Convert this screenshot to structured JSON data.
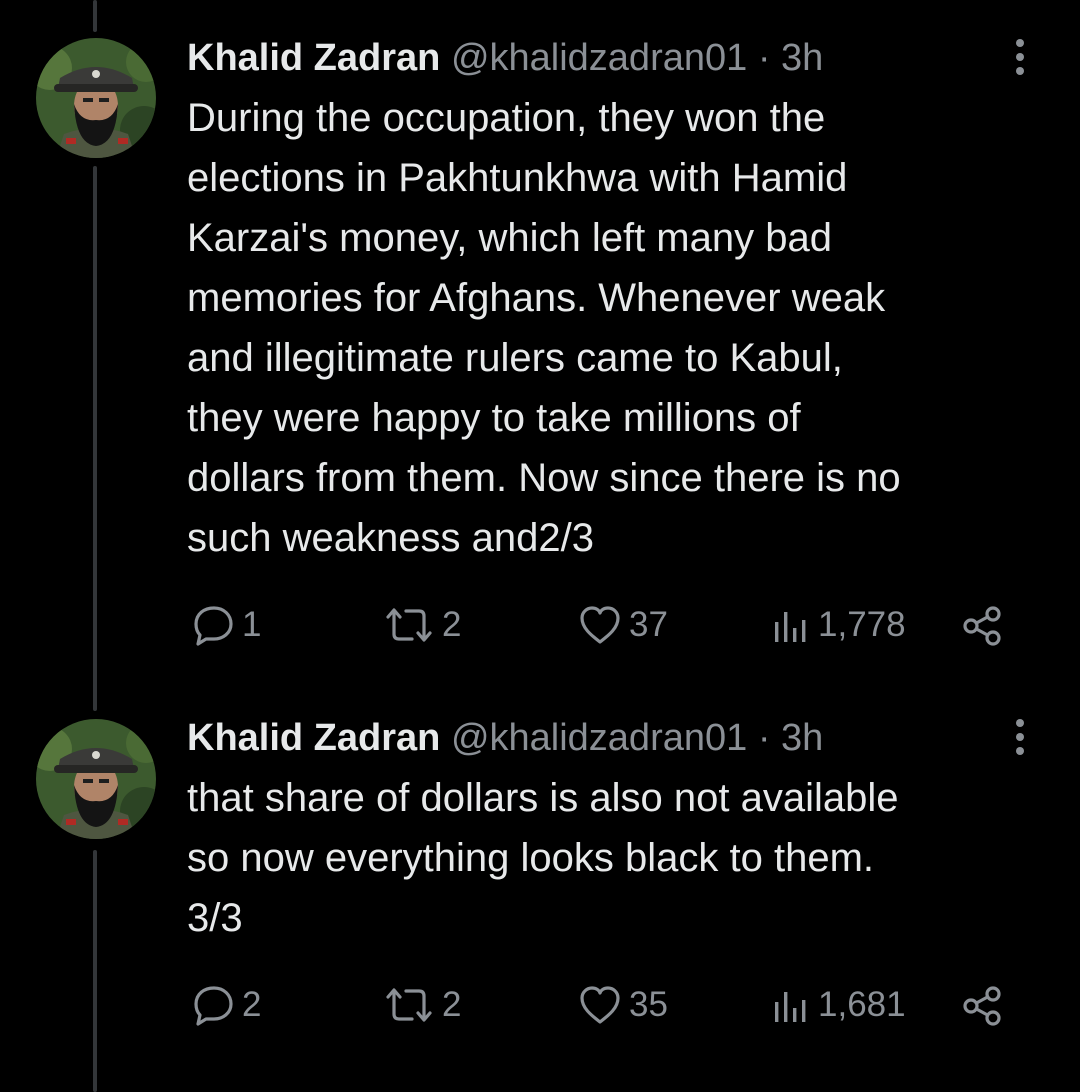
{
  "tweets": [
    {
      "name": "Khalid Zadran",
      "handle": "@khalidzadran01",
      "separator": "·",
      "time": "3h",
      "text": "During the occupation, they won the\nelections in Pakhtunkhwa with Hamid\nKarzai's money, which left many bad\nmemories for Afghans. Whenever weak\nand illegitimate rulers came to Kabul,\nthey were happy to take millions of\ndollars from them. Now since there is no\nsuch weakness and2/3",
      "replies": "1",
      "reposts": "2",
      "likes": "37",
      "views": "1,778"
    },
    {
      "name": "Khalid Zadran",
      "handle": "@khalidzadran01",
      "separator": "·",
      "time": "3h",
      "text": "that share of dollars is also not available\nso now everything looks black to them.\n3/3",
      "replies": "2",
      "reposts": "2",
      "likes": "35",
      "views": "1,681"
    }
  ],
  "icons": {
    "reply": "reply-icon",
    "repost": "repost-icon",
    "like": "heart-icon",
    "views": "views-icon",
    "share": "share-icon",
    "more": "more-icon"
  },
  "colors": {
    "background": "#000000",
    "text": "#e7e9ea",
    "secondary": "#8b9096",
    "thread_line": "#333639"
  }
}
